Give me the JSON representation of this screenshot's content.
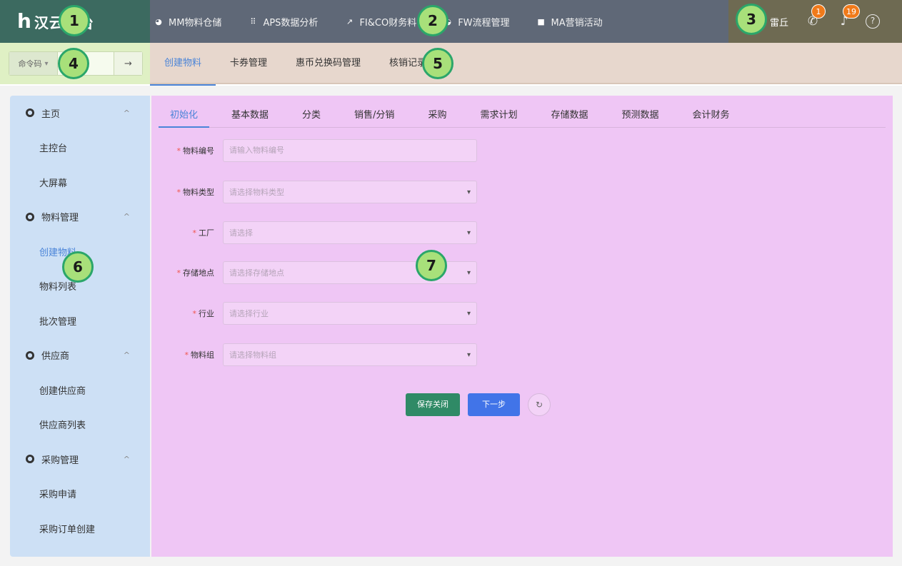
{
  "app": {
    "logo_mark": "h",
    "logo_text": "汉云后台"
  },
  "top_nav": [
    {
      "label": "MM物料仓储",
      "icon": "dashboard-icon",
      "glyph": "◕"
    },
    {
      "label": "APS数据分析",
      "icon": "grid-icon",
      "glyph": "⠿"
    },
    {
      "label": "FI&CO财务料",
      "icon": "trend-icon",
      "glyph": "↗"
    },
    {
      "label": "FW流程管理",
      "icon": "pie-icon",
      "glyph": "◒"
    },
    {
      "label": "MA营销活动",
      "icon": "square-icon",
      "glyph": "■"
    }
  ],
  "user": {
    "name": "雷丘",
    "phone_badge": "1",
    "bell_badge": "19",
    "help_glyph": "?"
  },
  "command": {
    "select_label": "命令码",
    "select_caret": "▾",
    "input_value": "",
    "go_glyph": "→"
  },
  "module_tabs": [
    {
      "label": "创建物料",
      "active": true
    },
    {
      "label": "卡券管理"
    },
    {
      "label": "惠币兑换码管理"
    },
    {
      "label": "核销记录"
    }
  ],
  "sidebar": {
    "groups": [
      {
        "label": "主页",
        "chevron": "^",
        "items": [
          "主控台",
          "大屏幕"
        ]
      },
      {
        "label": "物料管理",
        "chevron": "^",
        "items": [
          "创建物料",
          "物料列表",
          "批次管理"
        ]
      },
      {
        "label": "供应商",
        "chevron": "^",
        "items": [
          "创建供应商",
          "供应商列表"
        ]
      },
      {
        "label": "采购管理",
        "chevron": "^",
        "items": [
          "采购申请",
          "采购订单创建"
        ]
      }
    ],
    "active_item": "创建物料"
  },
  "inner_tabs": [
    {
      "label": "初始化",
      "active": true
    },
    {
      "label": "基本数据"
    },
    {
      "label": "分类"
    },
    {
      "label": "销售/分销"
    },
    {
      "label": "采购"
    },
    {
      "label": "需求计划"
    },
    {
      "label": "存储数据"
    },
    {
      "label": "预测数据"
    },
    {
      "label": "会计财务"
    }
  ],
  "form": {
    "required_mark": "*",
    "fields": [
      {
        "label": "物料编号",
        "placeholder": "请输入物料编号",
        "type": "input"
      },
      {
        "label": "物料类型",
        "placeholder": "请选择物料类型",
        "type": "select"
      },
      {
        "label": "工厂",
        "placeholder": "请选择",
        "type": "select"
      },
      {
        "label": "存储地点",
        "placeholder": "请选择存储地点",
        "type": "select"
      },
      {
        "label": "行业",
        "placeholder": "请选择行业",
        "type": "select"
      },
      {
        "label": "物料组",
        "placeholder": "请选择物料组",
        "type": "select"
      }
    ],
    "caret": "▾"
  },
  "buttons": {
    "save_close": "保存关闭",
    "next": "下一步",
    "refresh_glyph": "↻"
  },
  "markers": [
    "1",
    "2",
    "3",
    "4",
    "5",
    "6",
    "7"
  ],
  "colors": {
    "accent": "#4a84d8",
    "required": "#f0564e",
    "save_button": "#2f8a66",
    "next_button": "#4174e8",
    "badge": "#f07a1a",
    "marker_fill": "#a8e07a",
    "marker_border": "#2ba66a"
  }
}
